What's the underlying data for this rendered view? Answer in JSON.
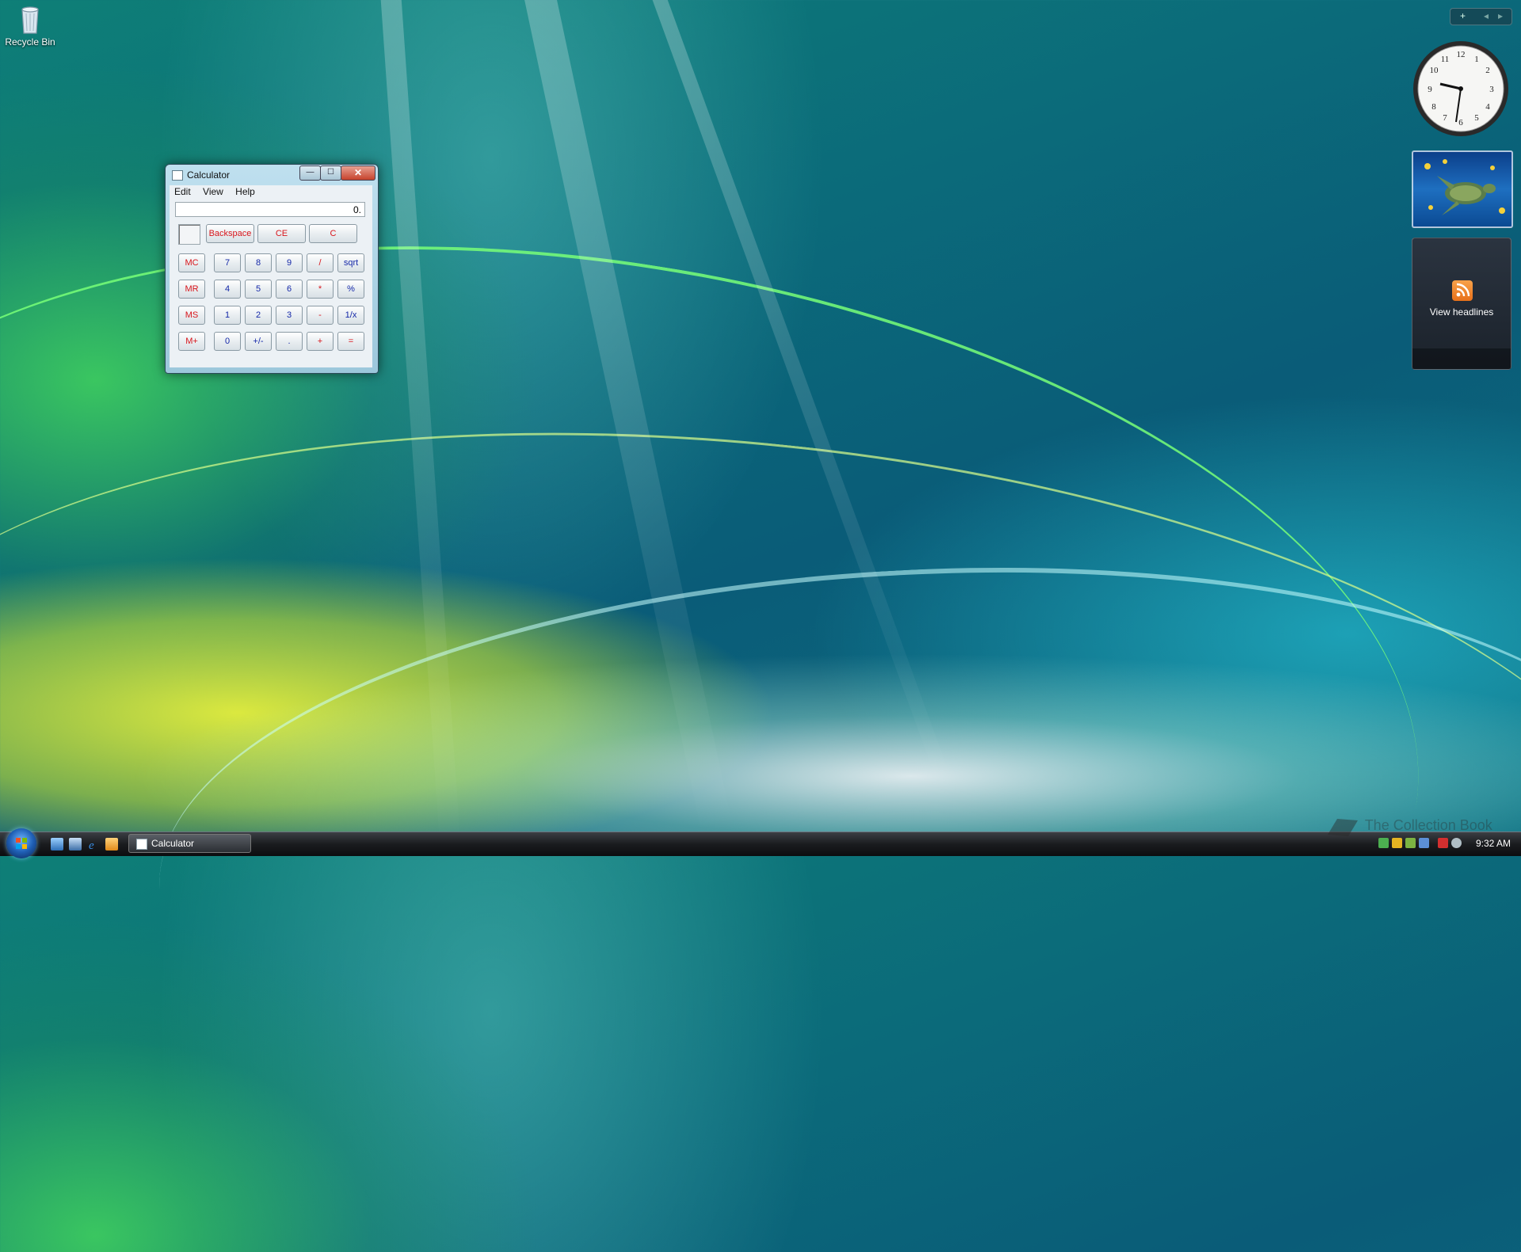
{
  "desktop": {
    "icons": [
      {
        "label": "Recycle Bin",
        "icon": "recycle-bin-icon"
      }
    ]
  },
  "calculator": {
    "title": "Calculator",
    "window_buttons": {
      "minimize": "—",
      "maximize": "☐",
      "close": "✕"
    },
    "menu": [
      "Edit",
      "View",
      "Help"
    ],
    "display": "0.",
    "buttons": {
      "backspace": "Backspace",
      "ce": "CE",
      "c": "C",
      "mc": "MC",
      "mr": "MR",
      "ms": "MS",
      "mplus": "M+",
      "n7": "7",
      "n8": "8",
      "n9": "9",
      "div": "/",
      "sqrt": "sqrt",
      "n4": "4",
      "n5": "5",
      "n6": "6",
      "mul": "*",
      "pct": "%",
      "n1": "1",
      "n2": "2",
      "n3": "3",
      "sub": "-",
      "recip": "1/x",
      "n0": "0",
      "sign": "+/-",
      "dot": ".",
      "add": "+",
      "eq": "="
    },
    "colors": {
      "red": "#d8151b",
      "blue": "#1528a8"
    }
  },
  "sidebar": {
    "controls": {
      "add": "+",
      "prev": "◂",
      "next": "▸"
    },
    "feed_label": "View headlines"
  },
  "taskbar": {
    "task_label": "Calculator",
    "time": "9:32 AM"
  },
  "watermark": "The Collection Book"
}
